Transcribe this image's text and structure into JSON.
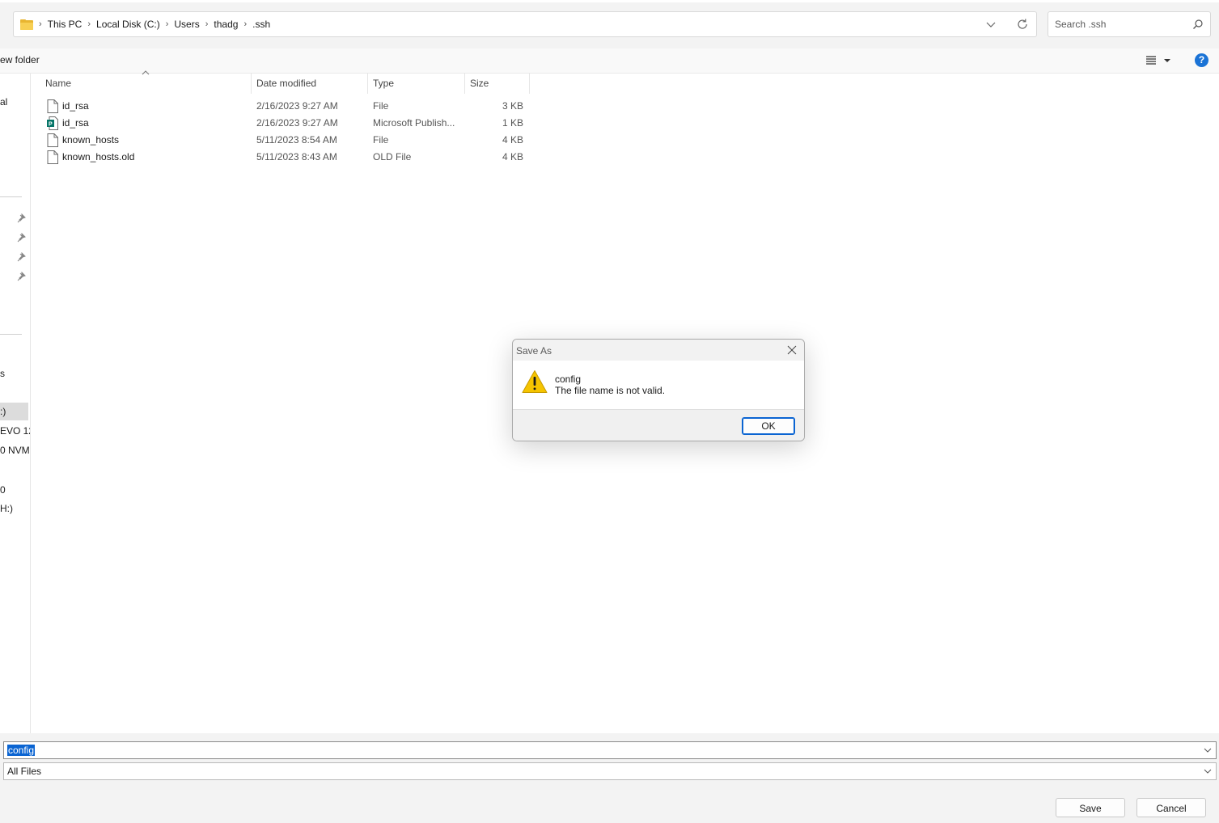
{
  "address": {
    "crumbs": [
      "This PC",
      "Local Disk (C:)",
      "Users",
      "thadg",
      ".ssh"
    ]
  },
  "search": {
    "placeholder": "Search .ssh"
  },
  "commandbar": {
    "new_folder": "ew folder",
    "help": "?"
  },
  "nav": {
    "items": [
      "al",
      "s",
      ":)",
      "EVO 12",
      "0 NVM",
      "0",
      "H:)"
    ]
  },
  "columns": {
    "name": "Name",
    "date": "Date modified",
    "type": "Type",
    "size": "Size"
  },
  "files": [
    {
      "name": "id_rsa",
      "date": "2/16/2023 9:27 AM",
      "type": "File",
      "size": "3 KB",
      "icon": "file-icon"
    },
    {
      "name": "id_rsa",
      "date": "2/16/2023 9:27 AM",
      "type": "Microsoft Publish...",
      "size": "1 KB",
      "icon": "publisher-icon"
    },
    {
      "name": "known_hosts",
      "date": "5/11/2023 8:54 AM",
      "type": "File",
      "size": "4 KB",
      "icon": "file-icon"
    },
    {
      "name": "known_hosts.old",
      "date": "5/11/2023 8:43 AM",
      "type": "OLD File",
      "size": "4 KB",
      "icon": "file-icon"
    }
  ],
  "bottom": {
    "filename": "config",
    "filetype": "All Files",
    "save": "Save",
    "cancel": "Cancel"
  },
  "dialog": {
    "title": "Save As",
    "line1": "config",
    "line2": "The file name is not valid.",
    "ok": "OK"
  },
  "colors": {
    "accent": "#0a64d2",
    "help": "#1a73d6",
    "warning": "#f5c400"
  }
}
